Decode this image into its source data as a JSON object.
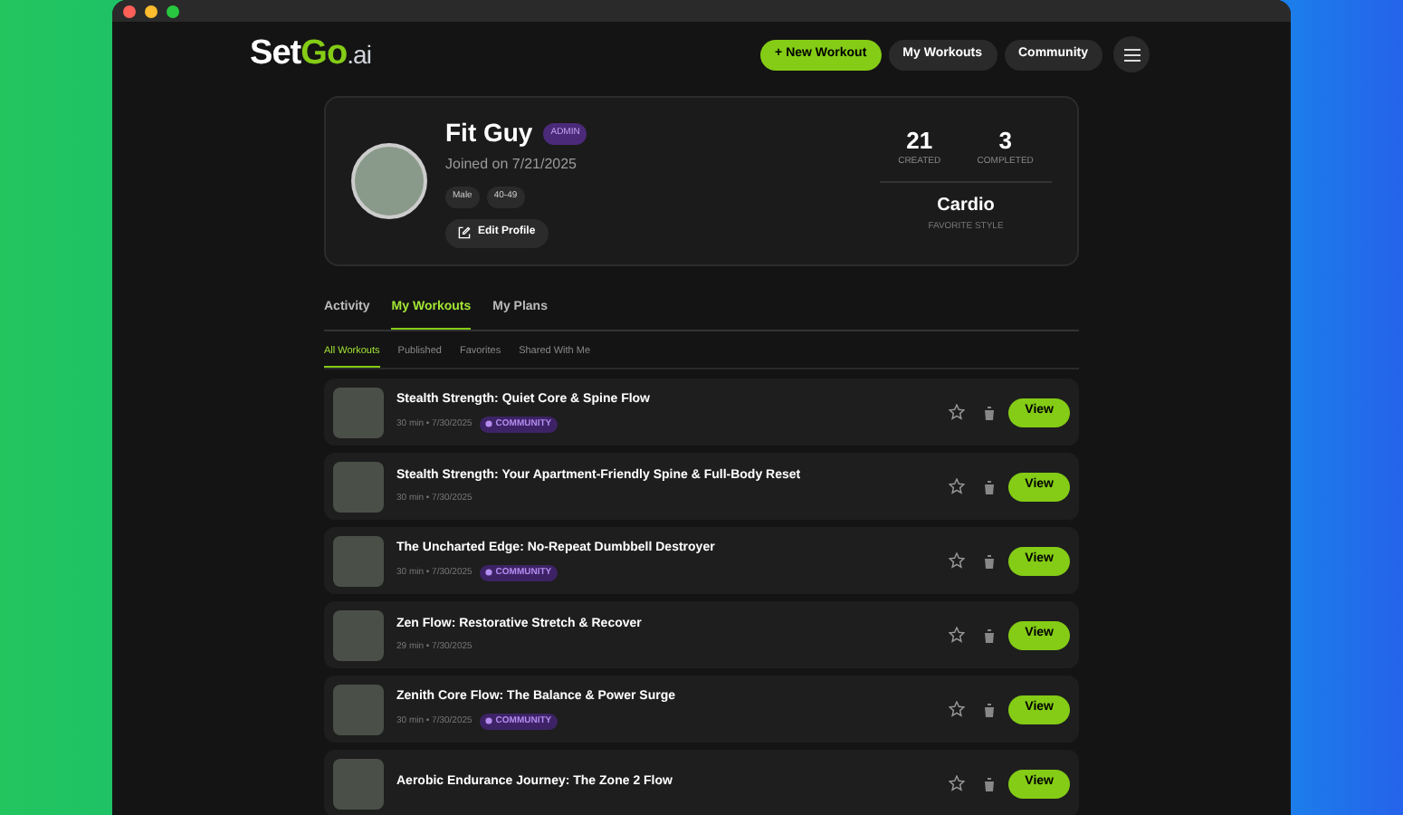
{
  "logo": {
    "brand": "SetGo",
    "suffix": ".ai"
  },
  "nav": [
    {
      "label": "+ New Workout",
      "kind": "primary"
    },
    {
      "label": "My Workouts",
      "kind": "secondary"
    },
    {
      "label": "Community",
      "kind": "secondary"
    }
  ],
  "profile": {
    "name": "Fit Guy",
    "role": "ADMIN",
    "joined": "Joined on 7/21/2025",
    "tags": [
      "Male",
      "40-49"
    ],
    "edit_button": "Edit Profile",
    "stats": [
      {
        "value": "21",
        "label": "CREATED"
      },
      {
        "value": "3",
        "label": "COMPLETED"
      }
    ],
    "favorite": {
      "value": "Cardio",
      "label": "FAVORITE STYLE"
    }
  },
  "tabs": [
    {
      "label": "Activity",
      "selected": false
    },
    {
      "label": "My Workouts",
      "selected": true
    },
    {
      "label": "My Plans",
      "selected": false
    }
  ],
  "subtabs": [
    {
      "label": "All Workouts",
      "selected": true
    },
    {
      "label": "Published",
      "selected": false
    },
    {
      "label": "Favorites",
      "selected": false
    },
    {
      "label": "Shared With Me",
      "selected": false
    }
  ],
  "workouts": [
    {
      "title": "Stealth Strength: Quiet Core & Spine Flow",
      "meta": "30 min • 7/30/2025",
      "badge": "COMMUNITY",
      "favorite": false,
      "action": "View"
    },
    {
      "title": "Stealth Strength: Your Apartment-Friendly Spine & Full-Body Reset",
      "meta": "30 min • 7/30/2025",
      "favorite": false,
      "action": "View"
    },
    {
      "title": "The Uncharted Edge: No-Repeat Dumbbell Destroyer",
      "meta": "30 min • 7/30/2025",
      "badge": "COMMUNITY",
      "favorite": false,
      "action": "View"
    },
    {
      "title": "Zen Flow: Restorative Stretch & Recover",
      "meta": "29 min • 7/30/2025",
      "favorite": false,
      "action": "View"
    },
    {
      "title": "Zenith Core Flow: The Balance & Power Surge",
      "meta": "30 min • 7/30/2025",
      "badge": "COMMUNITY",
      "favorite": false,
      "action": "View"
    },
    {
      "title": "Aerobic Endurance Journey: The Zone 2 Flow",
      "favorite": false,
      "action": "View"
    }
  ]
}
